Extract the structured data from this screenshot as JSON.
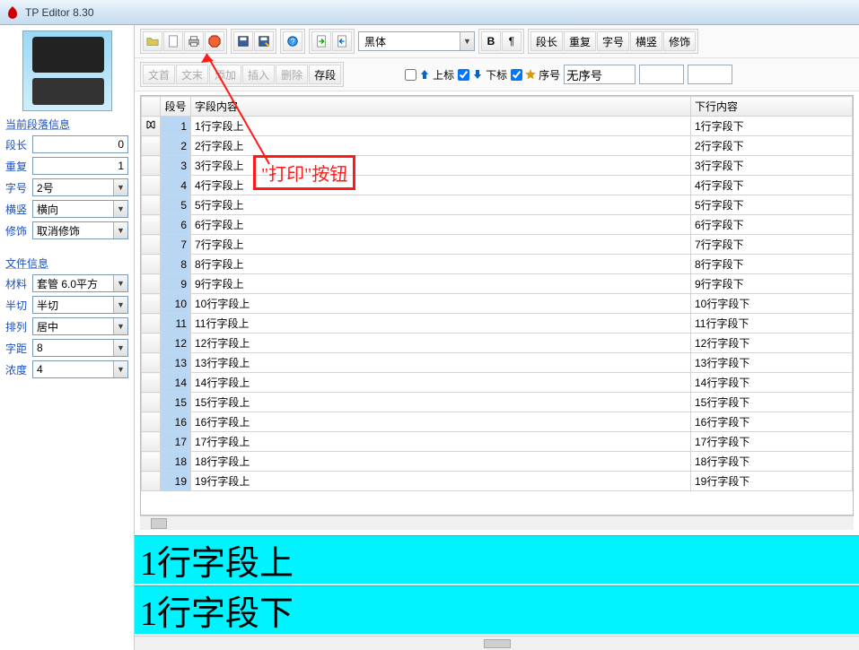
{
  "app": {
    "title": "TP Editor  8.30"
  },
  "toolbar1": {
    "font_select": "黑体",
    "btn_bold": "B",
    "btn_para": "¶",
    "btns_right": [
      "段长",
      "重复",
      "字号",
      "横竖",
      "修饰"
    ]
  },
  "toolbar2": {
    "left_btns": [
      "文首",
      "文末",
      "添加",
      "插入",
      "删除",
      "存段"
    ],
    "chk_up": "上标",
    "chk_down": "下标",
    "chk_seq": "序号",
    "seq_input": "无序号"
  },
  "section1": {
    "title": "当前段落信息",
    "seglen": {
      "label": "段长",
      "value": "0"
    },
    "repeat": {
      "label": "重复",
      "value": "1"
    },
    "font": {
      "label": "字号",
      "value": "2号"
    },
    "orient": {
      "label": "横竖",
      "value": "横向"
    },
    "decor": {
      "label": "修饰",
      "value": "取消修饰"
    }
  },
  "section2": {
    "title": "文件信息",
    "material": {
      "label": "材料",
      "value": "套管 6.0平方"
    },
    "halfcut": {
      "label": "半切",
      "value": "半切"
    },
    "align": {
      "label": "排列",
      "value": "居中"
    },
    "spacing": {
      "label": "字距",
      "value": "8"
    },
    "density": {
      "label": "浓度",
      "value": "4"
    }
  },
  "grid": {
    "headers": {
      "sel": "",
      "num": "段号",
      "upper": "字段内容",
      "lower": "下行内容"
    },
    "rows": [
      {
        "n": "1",
        "u": "1行字段上",
        "d": "1行字段下"
      },
      {
        "n": "2",
        "u": "2行字段上",
        "d": "2行字段下"
      },
      {
        "n": "3",
        "u": "3行字段上",
        "d": "3行字段下"
      },
      {
        "n": "4",
        "u": "4行字段上",
        "d": "4行字段下"
      },
      {
        "n": "5",
        "u": "5行字段上",
        "d": "5行字段下"
      },
      {
        "n": "6",
        "u": "6行字段上",
        "d": "6行字段下"
      },
      {
        "n": "7",
        "u": "7行字段上",
        "d": "7行字段下"
      },
      {
        "n": "8",
        "u": "8行字段上",
        "d": "8行字段下"
      },
      {
        "n": "9",
        "u": "9行字段上",
        "d": "9行字段下"
      },
      {
        "n": "10",
        "u": "10行字段上",
        "d": "10行字段下"
      },
      {
        "n": "11",
        "u": "11行字段上",
        "d": "11行字段下"
      },
      {
        "n": "12",
        "u": "12行字段上",
        "d": "12行字段下"
      },
      {
        "n": "13",
        "u": "13行字段上",
        "d": "13行字段下"
      },
      {
        "n": "14",
        "u": "14行字段上",
        "d": "14行字段下"
      },
      {
        "n": "15",
        "u": "15行字段上",
        "d": "15行字段下"
      },
      {
        "n": "16",
        "u": "16行字段上",
        "d": "16行字段下"
      },
      {
        "n": "17",
        "u": "17行字段上",
        "d": "17行字段下"
      },
      {
        "n": "18",
        "u": "18行字段上",
        "d": "18行字段下"
      },
      {
        "n": "19",
        "u": "19行字段上",
        "d": "19行字段下"
      }
    ]
  },
  "preview": {
    "line1": "1行字段上",
    "line2": "1行字段下"
  },
  "annotation": {
    "label": "\"打印\"按钮"
  }
}
